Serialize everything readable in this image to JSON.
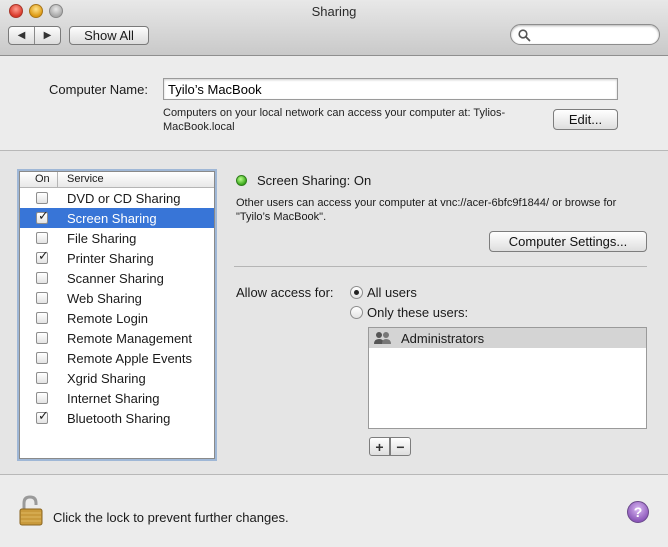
{
  "window": {
    "title": "Sharing"
  },
  "toolbar": {
    "show_all_label": "Show All",
    "search_placeholder": ""
  },
  "computer_name": {
    "label": "Computer Name:",
    "value": "Tyilo’s MacBook",
    "note": "Computers on your local network can access your computer at: Tylios-MacBook.local",
    "edit_label": "Edit..."
  },
  "services": {
    "header_on": "On",
    "header_service": "Service",
    "items": [
      {
        "label": "DVD or CD Sharing",
        "checked": false,
        "selected": false
      },
      {
        "label": "Screen Sharing",
        "checked": true,
        "selected": true
      },
      {
        "label": "File Sharing",
        "checked": false,
        "selected": false
      },
      {
        "label": "Printer Sharing",
        "checked": true,
        "selected": false
      },
      {
        "label": "Scanner Sharing",
        "checked": false,
        "selected": false
      },
      {
        "label": "Web Sharing",
        "checked": false,
        "selected": false
      },
      {
        "label": "Remote Login",
        "checked": false,
        "selected": false
      },
      {
        "label": "Remote Management",
        "checked": false,
        "selected": false
      },
      {
        "label": "Remote Apple Events",
        "checked": false,
        "selected": false
      },
      {
        "label": "Xgrid Sharing",
        "checked": false,
        "selected": false
      },
      {
        "label": "Internet Sharing",
        "checked": false,
        "selected": false
      },
      {
        "label": "Bluetooth Sharing",
        "checked": true,
        "selected": false
      }
    ]
  },
  "detail": {
    "status": "Screen Sharing: On",
    "status_color": "#3aa81b",
    "info": "Other users can access your computer at vnc://acer-6bfc9f1844/ or browse for \"Tyilo’s MacBook\".",
    "computer_settings_label": "Computer Settings...",
    "allow_access_label": "Allow access for:",
    "all_users_label": "All users",
    "only_users_label": "Only these users:",
    "selected_access": "all",
    "users": [
      "Administrators"
    ],
    "add_label": "+",
    "remove_label": "−"
  },
  "footer": {
    "lock_text": "Click the lock to prevent further changes.",
    "help_label": "?"
  },
  "colors": {
    "selection": "#3875d7",
    "help": "#8a55b8"
  }
}
